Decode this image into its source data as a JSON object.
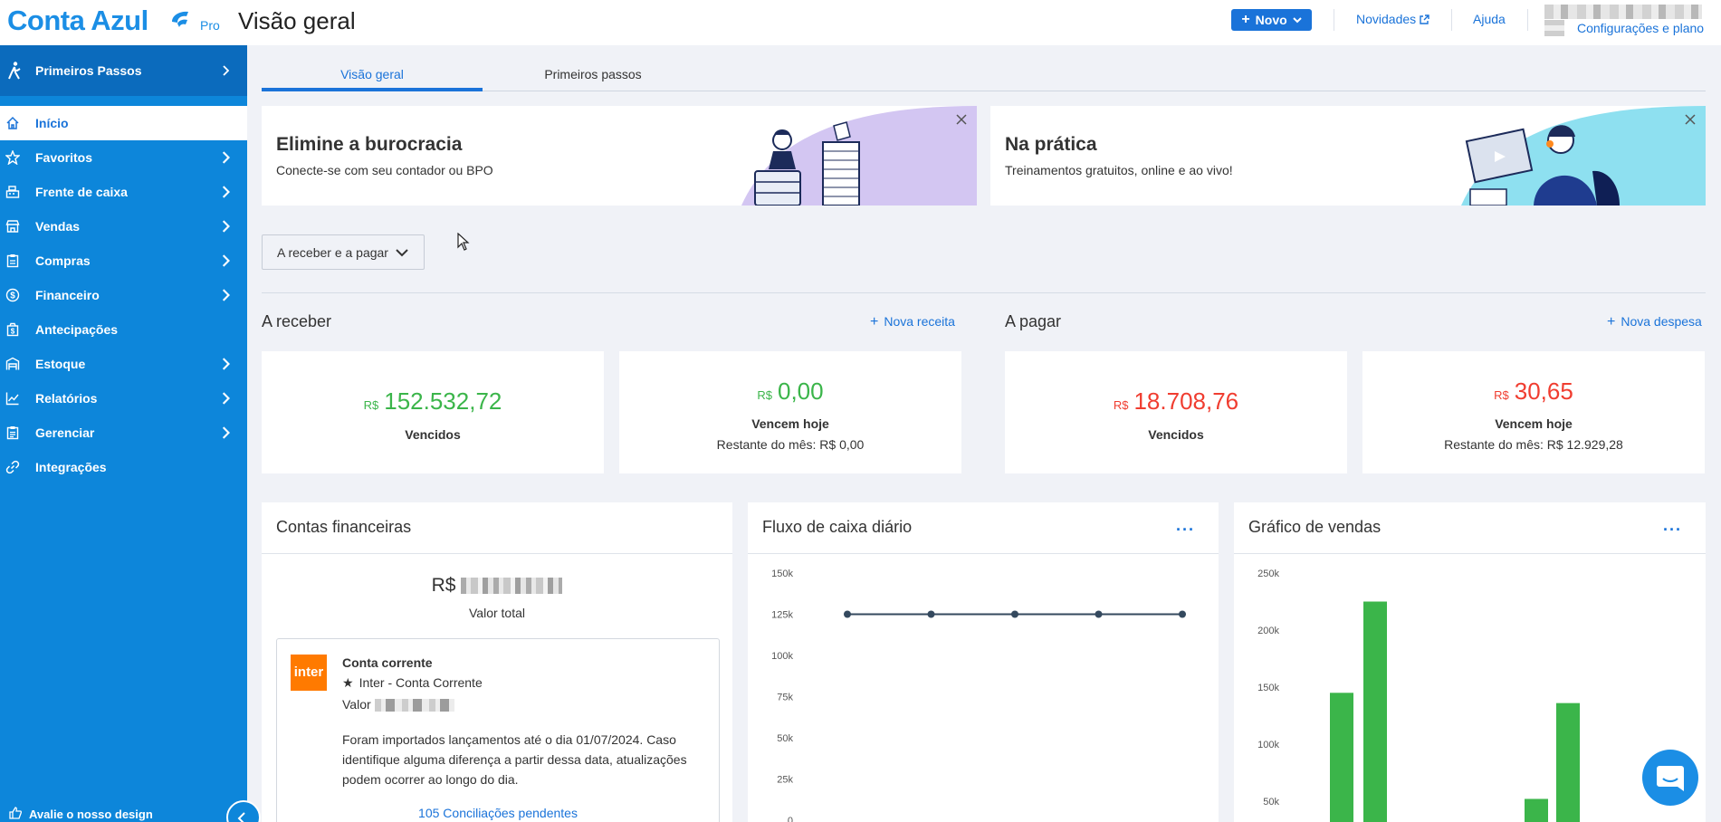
{
  "header": {
    "logo_text": "Conta Azul",
    "logo_badge": "Pro",
    "page_title": "Visão geral",
    "novo_label": "Novo",
    "novidades_label": "Novidades",
    "ajuda_label": "Ajuda",
    "config_label": "Configurações e plano"
  },
  "sidebar": {
    "first_steps": "Primeiros Passos",
    "items": [
      {
        "label": "Início",
        "icon": "home-icon",
        "chevron": false,
        "active": true
      },
      {
        "label": "Favoritos",
        "icon": "star-icon",
        "chevron": true
      },
      {
        "label": "Frente de caixa",
        "icon": "cash-register-icon",
        "chevron": true
      },
      {
        "label": "Vendas",
        "icon": "store-icon",
        "chevron": true
      },
      {
        "label": "Compras",
        "icon": "clipboard-icon",
        "chevron": true
      },
      {
        "label": "Financeiro",
        "icon": "dollar-icon",
        "chevron": true
      },
      {
        "label": "Antecipações",
        "icon": "money-bag-icon",
        "chevron": false
      },
      {
        "label": "Estoque",
        "icon": "warehouse-icon",
        "chevron": true
      },
      {
        "label": "Relatórios",
        "icon": "chart-icon",
        "chevron": true
      },
      {
        "label": "Gerenciar",
        "icon": "clipboard-list-icon",
        "chevron": true
      },
      {
        "label": "Integrações",
        "icon": "link-icon",
        "chevron": false
      }
    ],
    "footer_label": "Avalie o nosso design"
  },
  "tabs": [
    {
      "label": "Visão geral",
      "active": true
    },
    {
      "label": "Primeiros passos",
      "active": false
    }
  ],
  "banners": [
    {
      "title": "Elimine a burocracia",
      "subtitle": "Conecte-se com seu contador ou BPO"
    },
    {
      "title": "Na prática",
      "subtitle": "Treinamentos gratuitos, online e ao vivo!"
    }
  ],
  "filter_dropdown": "A receber e a pagar",
  "receber": {
    "title": "A receber",
    "link": "Nova receita",
    "cards": [
      {
        "currency": "R$",
        "amount": "152.532,72",
        "label": "Vencidos",
        "rest": ""
      },
      {
        "currency": "R$",
        "amount": "0,00",
        "label": "Vencem hoje",
        "rest": "Restante do mês: R$ 0,00"
      }
    ]
  },
  "pagar": {
    "title": "A pagar",
    "link": "Nova despesa",
    "cards": [
      {
        "currency": "R$",
        "amount": "18.708,76",
        "label": "Vencidos",
        "rest": ""
      },
      {
        "currency": "R$",
        "amount": "30,65",
        "label": "Vencem hoje",
        "rest": "Restante do mês: R$ 12.929,28"
      }
    ]
  },
  "contas": {
    "title": "Contas financeiras",
    "total_currency": "R$",
    "total_label": "Valor total",
    "account": {
      "bank_logo": "inter",
      "type": "Conta corrente",
      "name": "Inter - Conta Corrente",
      "value_label": "Valor",
      "note": "Foram importados lançamentos até o dia 01/07/2024. Caso identifique alguma diferença a partir dessa data, atualizações podem ocorrer ao longo do dia.",
      "pending_link": "105 Conciliações pendentes"
    }
  },
  "fluxo": {
    "title": "Fluxo de caixa diário",
    "more": "···"
  },
  "vendas": {
    "title": "Gráfico de vendas",
    "more": "···"
  },
  "chart_data": [
    {
      "type": "line",
      "title": "Fluxo de caixa diário",
      "yticks": [
        "150k",
        "125k",
        "100k",
        "75k",
        "50k",
        "25k",
        "0"
      ],
      "ylim": [
        0,
        150000
      ],
      "series": [
        {
          "values": [
            125000,
            125000,
            125000,
            125000,
            125000
          ]
        }
      ],
      "color": "#34495e"
    },
    {
      "type": "bar",
      "title": "Gráfico de vendas",
      "yticks": [
        "250k",
        "200k",
        "150k",
        "100k",
        "50k"
      ],
      "ylim": [
        0,
        250000
      ],
      "series": [
        {
          "values": [
            145000,
            225000,
            52000,
            136000
          ]
        }
      ],
      "color": "#3bb54a"
    }
  ],
  "colors": {
    "brand": "#1b8ee5",
    "sidebar": "#0d86da",
    "positive": "#3bb54a",
    "negative": "#f03d30"
  }
}
